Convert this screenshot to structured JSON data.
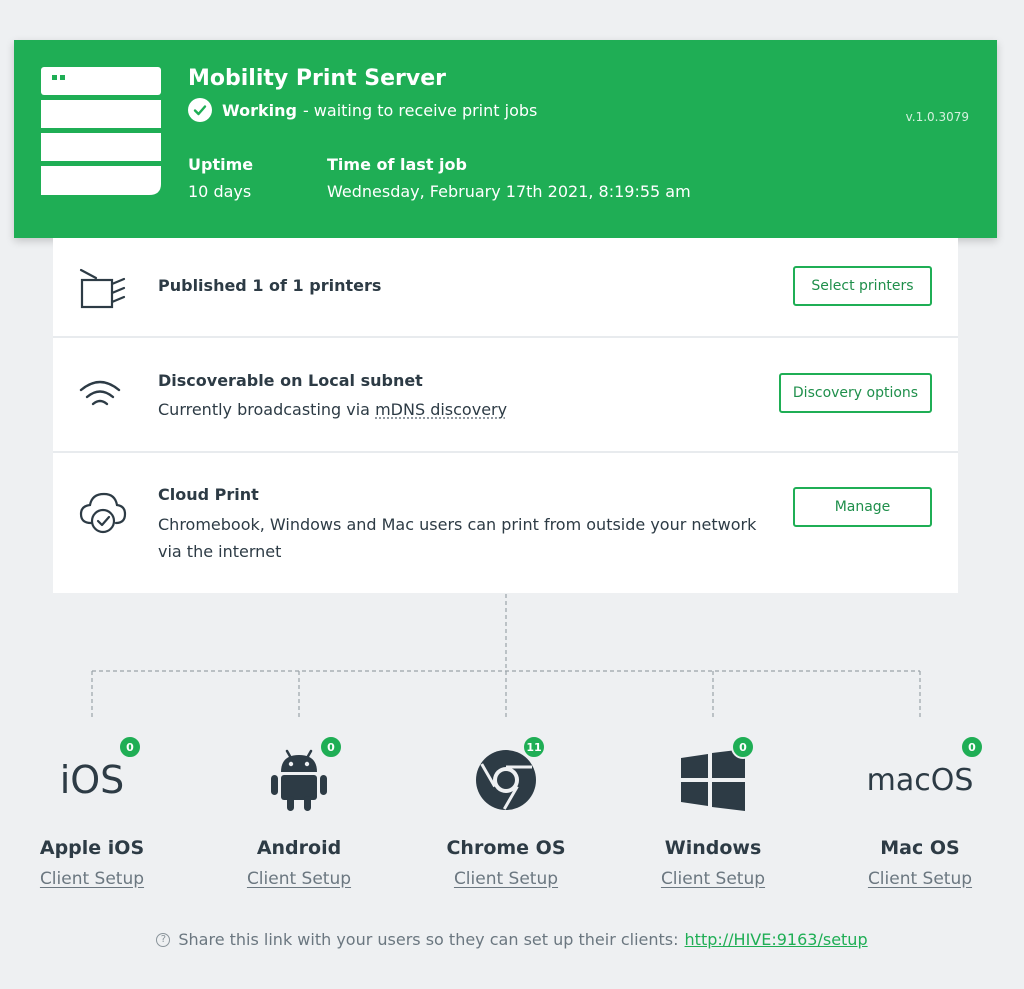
{
  "colors": {
    "brand_green": "#1fae55",
    "text": "#2d3b45",
    "muted": "#6b7780",
    "background": "#eef0f2"
  },
  "header": {
    "title": "Mobility Print Server",
    "status_strong": "Working",
    "status_text": "- waiting to receive print jobs",
    "version": "v.1.0.3079",
    "uptime_label": "Uptime",
    "uptime_value": "10 days",
    "last_job_label": "Time of last job",
    "last_job_value": "Wednesday, February 17th 2021, 8:19:55 am",
    "icons": {
      "server": "server-stack-icon",
      "status": "check-circle-icon"
    }
  },
  "cards": {
    "printers": {
      "title": "Published 1 of 1 printers",
      "button": "Select printers",
      "icon": "printer-icon"
    },
    "discovery": {
      "title": "Discoverable on Local subnet",
      "desc_prefix": "Currently broadcasting via ",
      "desc_link": "mDNS discovery",
      "button": "Discovery options",
      "icon": "wifi-icon"
    },
    "cloud": {
      "title": "Cloud Print",
      "desc": "Chromebook, Windows and Mac users can print from outside your network via the internet",
      "button": "Manage",
      "icon": "cloud-check-icon"
    }
  },
  "platforms": [
    {
      "logo_text": "iOS",
      "count": "0",
      "name": "Apple iOS",
      "link": "Client Setup",
      "icon": "ios-logo-icon"
    },
    {
      "count": "0",
      "name": "Android",
      "link": "Client Setup",
      "icon": "android-icon"
    },
    {
      "count": "11",
      "name": "Chrome OS",
      "link": "Client Setup",
      "icon": "chrome-icon"
    },
    {
      "count": "0",
      "name": "Windows",
      "link": "Client Setup",
      "icon": "windows-icon"
    },
    {
      "logo_text": "macOS",
      "count": "0",
      "name": "Mac OS",
      "link": "Client Setup",
      "icon": "macos-logo-icon"
    }
  ],
  "footer": {
    "text": "Share this link with your users so they can set up their clients:",
    "link": "http://HIVE:9163/setup",
    "icon": "help-circle-icon"
  }
}
